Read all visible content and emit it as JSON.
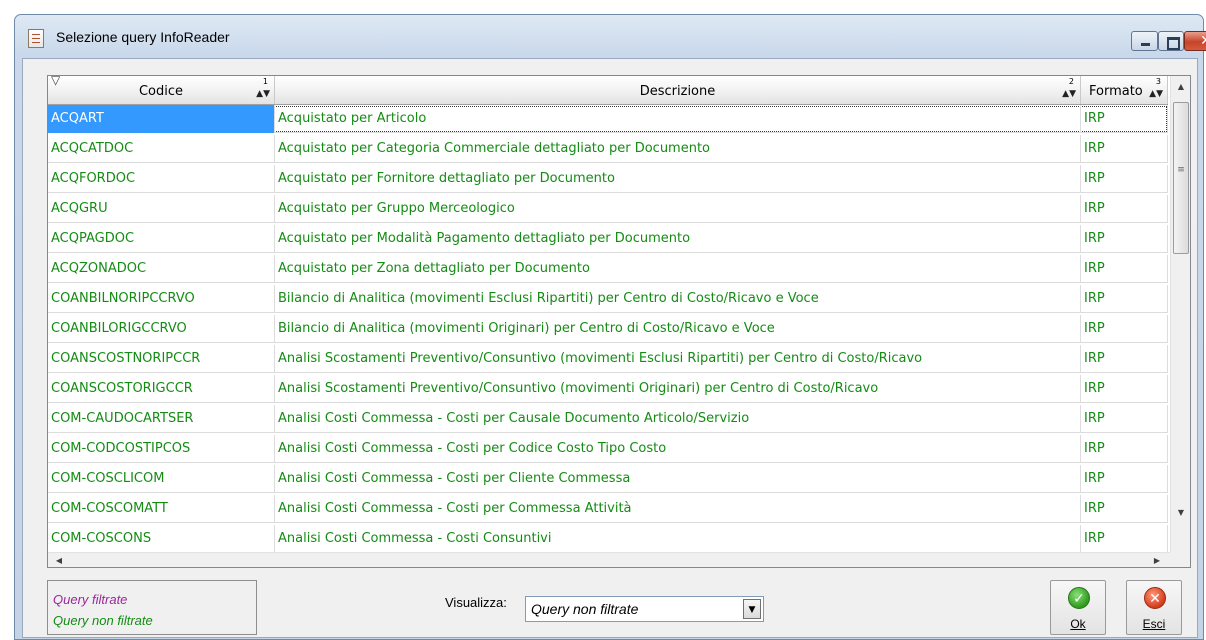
{
  "window": {
    "title": "Selezione query InfoReader",
    "buttons": {
      "minimize": "minimize-icon",
      "maximize": "maximize-icon",
      "close": "✕"
    }
  },
  "grid": {
    "columns": [
      {
        "label": "Codice",
        "sort_index": "1"
      },
      {
        "label": "Descrizione",
        "sort_index": "2"
      },
      {
        "label": "Formato",
        "sort_index": "3"
      }
    ],
    "rows": [
      {
        "code": "ACQART",
        "description": "Acquistato per Articolo",
        "format": "IRP"
      },
      {
        "code": "ACQCATDOC",
        "description": "Acquistato per Categoria Commerciale dettagliato per Documento",
        "format": "IRP"
      },
      {
        "code": "ACQFORDOC",
        "description": "Acquistato per Fornitore dettagliato per Documento",
        "format": "IRP"
      },
      {
        "code": "ACQGRU",
        "description": "Acquistato per Gruppo Merceologico",
        "format": "IRP"
      },
      {
        "code": "ACQPAGDOC",
        "description": "Acquistato per Modalità Pagamento dettagliato per Documento",
        "format": "IRP"
      },
      {
        "code": "ACQZONADOC",
        "description": "Acquistato per Zona dettagliato per Documento",
        "format": "IRP"
      },
      {
        "code": "COANBILNORIPCCRVO",
        "description": "Bilancio di Analitica (movimenti Esclusi Ripartiti) per Centro di Costo/Ricavo e Voce",
        "format": "IRP"
      },
      {
        "code": "COANBILORIGCCRVO",
        "description": "Bilancio di Analitica (movimenti Originari) per Centro di Costo/Ricavo e Voce",
        "format": "IRP"
      },
      {
        "code": "COANSCOSTNORIPCCR",
        "description": "Analisi Scostamenti Preventivo/Consuntivo (movimenti Esclusi Ripartiti) per Centro di Costo/Ricavo",
        "format": "IRP"
      },
      {
        "code": "COANSCOSTORIGCCR",
        "description": "Analisi Scostamenti Preventivo/Consuntivo (movimenti Originari) per Centro di Costo/Ricavo",
        "format": "IRP"
      },
      {
        "code": "COM-CAUDOCARTSER",
        "description": "Analisi Costi Commessa - Costi per Causale Documento Articolo/Servizio",
        "format": "IRP"
      },
      {
        "code": "COM-CODCOSTIPCOS",
        "description": "Analisi Costi Commessa - Costi per Codice Costo Tipo Costo",
        "format": "IRP"
      },
      {
        "code": "COM-COSCLICOM",
        "description": "Analisi Costi Commessa - Costi per Cliente Commessa",
        "format": "IRP"
      },
      {
        "code": "COM-COSCOMATT",
        "description": "Analisi Costi Commessa - Costi per Commessa Attività",
        "format": "IRP"
      },
      {
        "code": "COM-COSCONS",
        "description": "Analisi Costi Commessa - Costi Consuntivi",
        "format": "IRP"
      }
    ],
    "selected_row": 0
  },
  "legend": {
    "filtered": "Query filtrate",
    "unfiltered": "Query non filtrate",
    "filtered_color": "#9b289b",
    "unfiltered_color": "#148c14"
  },
  "view": {
    "label": "Visualizza:",
    "selected": "Query non filtrate"
  },
  "actions": {
    "ok_label": "Ok",
    "cancel_label": "Esci",
    "ok_icon": "check-icon",
    "cancel_icon": "x-icon"
  }
}
